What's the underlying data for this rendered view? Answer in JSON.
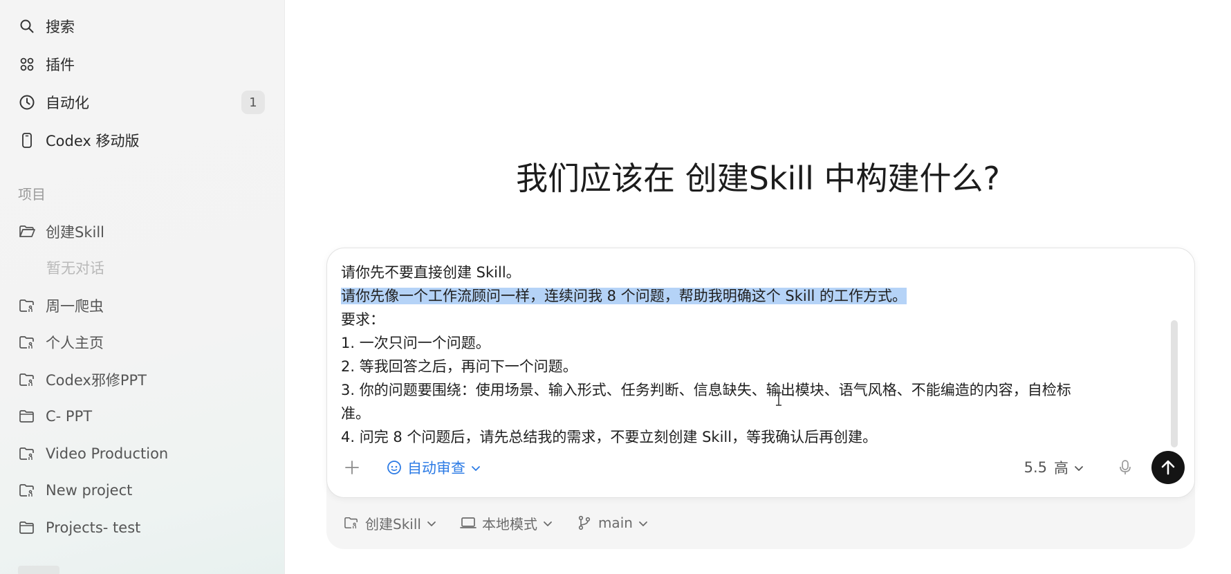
{
  "sidebar": {
    "nav": [
      {
        "label": "搜索",
        "icon": "search-icon"
      },
      {
        "label": "插件",
        "icon": "plugins-icon"
      },
      {
        "label": "自动化",
        "icon": "clock-icon",
        "badge": "1"
      },
      {
        "label": "Codex 移动版",
        "icon": "mobile-icon"
      }
    ],
    "section_label": "项目",
    "projects": [
      {
        "label": "创建Skill",
        "icon": "folder-open-icon"
      },
      {
        "label": "周一爬虫",
        "icon": "folder-branch-icon"
      },
      {
        "label": "个人主页",
        "icon": "folder-branch-icon"
      },
      {
        "label": "Codex邪修PPT",
        "icon": "folder-branch-icon"
      },
      {
        "label": "C- PPT",
        "icon": "folder-icon"
      },
      {
        "label": "Video Production",
        "icon": "folder-branch-icon"
      },
      {
        "label": "New project",
        "icon": "folder-branch-icon"
      },
      {
        "label": "Projects- test",
        "icon": "folder-icon"
      }
    ],
    "empty_note": "暂无对话"
  },
  "main": {
    "headline": "我们应该在 创建Skill 中构建什么?",
    "prompt_lines": [
      "请你先不要直接创建 Skill。",
      "请你先像一个工作流顾问一样，连续问我 8 个问题，帮助我明确这个 Skill 的工作方式。",
      "要求：",
      "1. 一次只问一个问题。",
      "2. 等我回答之后，再问下一个问题。",
      "3. 你的问题要围绕：使用场景、输入形式、任务判断、信息缺失、输出模块、语气风格、不能编造的内容，自检标",
      "准。",
      "4. 问完 8 个问题后，请先总结我的需求，不要立刻创建 Skill，等我确认后再创建。"
    ],
    "toolbar": {
      "auto_review": "自动审查",
      "model_version": "5.5",
      "model_effort": "高"
    },
    "footer": {
      "project": "创建Skill",
      "mode": "本地模式",
      "branch": "main"
    }
  },
  "colors": {
    "accent": "#2c7be5",
    "selection": "#b5d3f7",
    "send_button": "#141414"
  }
}
